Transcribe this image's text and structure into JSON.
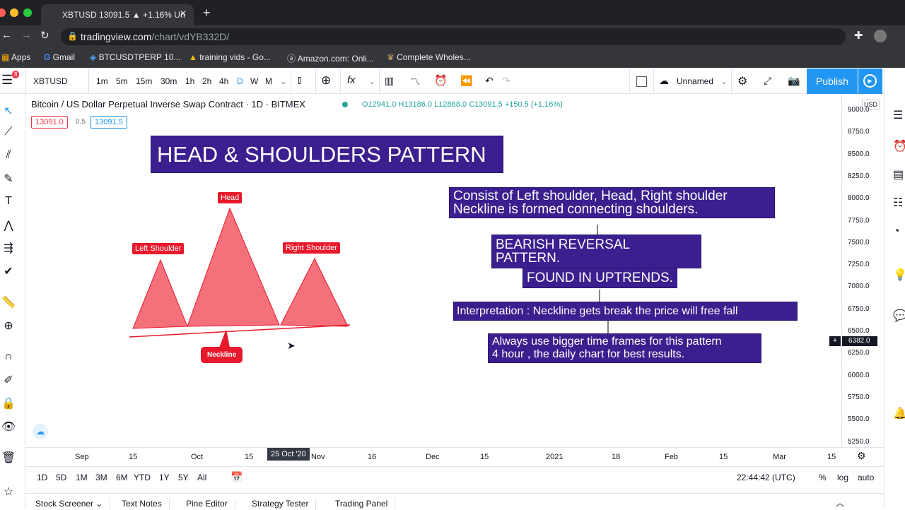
{
  "browser": {
    "tab_title": "XBTUSD 13091.5 ▲ +1.16% Un",
    "url_host": "tradingview.com",
    "url_path": "/chart/vdYB332D/",
    "bookmarks": [
      "Apps",
      "Gmail",
      "BTCUSDTPERP 10...",
      "training vids - Go...",
      "Amazon.com: Onli...",
      "Complete Wholes..."
    ]
  },
  "toolbar": {
    "symbol": "XBTUSD",
    "notifications": "8",
    "intervals": [
      "1m",
      "5m",
      "15m",
      "30m",
      "1h",
      "2h",
      "4h",
      "D",
      "W",
      "M"
    ],
    "active_interval": "D",
    "layout_name": "Unnamed",
    "publish_label": "Publish"
  },
  "legend": {
    "title": "Bitcoin / US Dollar Perpetual Inverse Swap Contract · 1D · BITMEX",
    "ohlc": "O12941.0 H13186.0 L12888.0 C13091.5 +150.5 (+1.16%)",
    "bid": "13091.0",
    "spread": "0.5",
    "ask": "13091.5"
  },
  "price_axis": {
    "currency": "USD",
    "labels": [
      "9000.0",
      "8750.0",
      "8500.0",
      "8250.0",
      "8000.0",
      "7750.0",
      "7500.0",
      "7250.0",
      "7000.0",
      "6750.0",
      "6500.0",
      "6250.0",
      "6000.0",
      "5750.0",
      "5500.0",
      "5250.0"
    ],
    "crosshair_price": "6382.0"
  },
  "time_axis": {
    "labels": [
      "Sep",
      "15",
      "Oct",
      "15",
      "Nov",
      "16",
      "Dec",
      "15",
      "2021",
      "18",
      "Feb",
      "15",
      "Mar",
      "15"
    ],
    "crosshair_date": "25 Oct '20"
  },
  "drawing": {
    "title": "HEAD & SHOULDERS PATTERN",
    "head": "Head",
    "left_shoulder": "Left Shoulder",
    "right_shoulder": "Right Shoulder",
    "neckline": "Neckline",
    "notes": [
      "Consist of Left shoulder, Head, Right shoulder",
      "Neckline is formed connecting shoulders.",
      "BEARISH REVERSAL PATTERN.",
      "FOUND IN UPTRENDS.",
      "Interpretation : Neckline gets break the price will free fall",
      "Always use bigger time frames for this pattern",
      "4 hour , the daily chart for best results."
    ],
    "box_color": "#3b1f8f",
    "shape_color": "#f4707a"
  },
  "bottom_bar": {
    "ranges": [
      "1D",
      "5D",
      "1M",
      "3M",
      "6M",
      "YTD",
      "1Y",
      "5Y",
      "All"
    ],
    "clock": "22:44:42 (UTC)",
    "options": [
      "%",
      "log",
      "auto"
    ]
  },
  "bottom_tabs": [
    "Stock Screener",
    "Text Notes",
    "Pine Editor",
    "Strategy Tester",
    "Trading Panel"
  ]
}
